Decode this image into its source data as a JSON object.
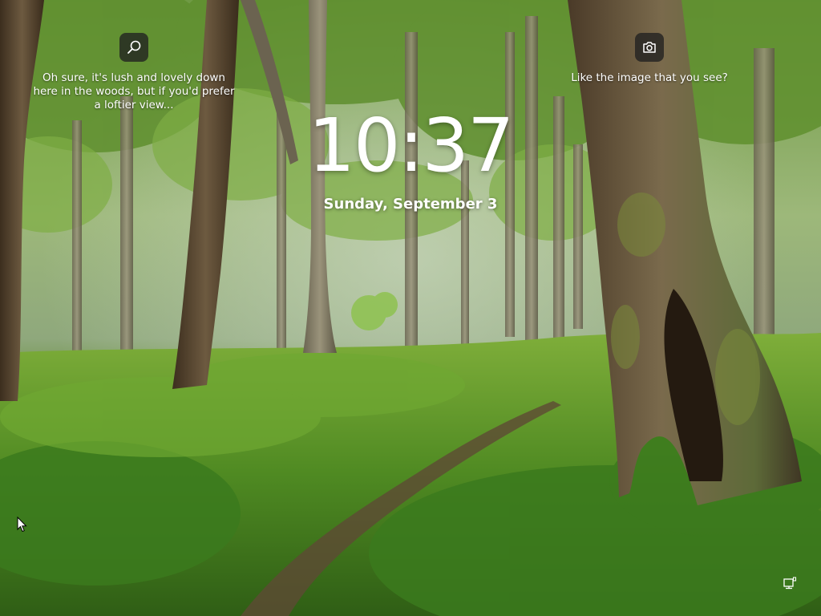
{
  "lock_screen": {
    "time": "10:37",
    "date": "Sunday, September 3"
  },
  "spotlight": {
    "search_hint": {
      "icon": "search-icon",
      "caption": "Oh sure, it's lush and lovely down here in the woods, but if you'd prefer a loftier view..."
    },
    "image_info": {
      "icon": "camera-icon",
      "caption": "Like the image that you see?"
    }
  },
  "status": {
    "network_icon": "network-ethernet-icon"
  },
  "colors": {
    "text": "#ffffff",
    "hotspot_bg": "#202020"
  }
}
